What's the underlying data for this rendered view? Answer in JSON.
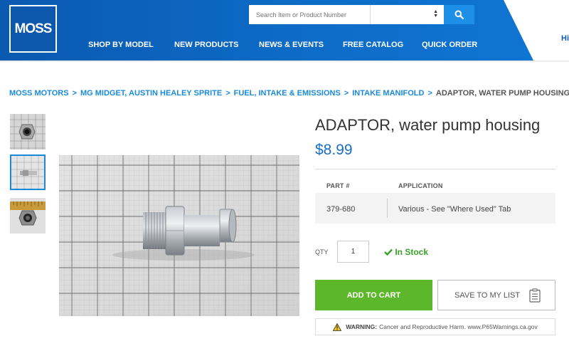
{
  "header": {
    "logo_text": "MOSS",
    "search": {
      "placeholder": "Search Item or Product Number"
    },
    "nav": [
      "SHOP BY MODEL",
      "NEW PRODUCTS",
      "NEWS & EVENTS",
      "FREE CATALOG",
      "QUICK ORDER"
    ],
    "greeting": "Hi"
  },
  "breadcrumb": {
    "links": [
      "MOSS MOTORS",
      "MG MIDGET, AUSTIN HEALEY SPRITE",
      "FUEL, INTAKE & EMISSIONS",
      "INTAKE MANIFOLD"
    ],
    "separator": ">",
    "current": "ADAPTOR, WATER PUMP HOUSING"
  },
  "product": {
    "title": "ADAPTOR, water pump housing",
    "price": "$8.99",
    "columns": [
      "PART #",
      "APPLICATION"
    ],
    "part_number": "379-680",
    "application": "Various - See \"Where Used\" Tab",
    "qty_label": "QTY",
    "qty_value": "1",
    "stock_status": "In Stock",
    "add_to_cart": "ADD TO CART",
    "save_to_list": "SAVE TO MY LIST",
    "warning_label": "WARNING:",
    "warning_text": "Cancer and Reproductive Harm. www.P65Warnings.ca.gov"
  },
  "colors": {
    "brand_blue": "#0b58ad",
    "link_blue": "#1a8ad8",
    "price_blue": "#1a6fc4",
    "cart_green": "#5cb82a",
    "stock_green": "#3aa12b"
  }
}
